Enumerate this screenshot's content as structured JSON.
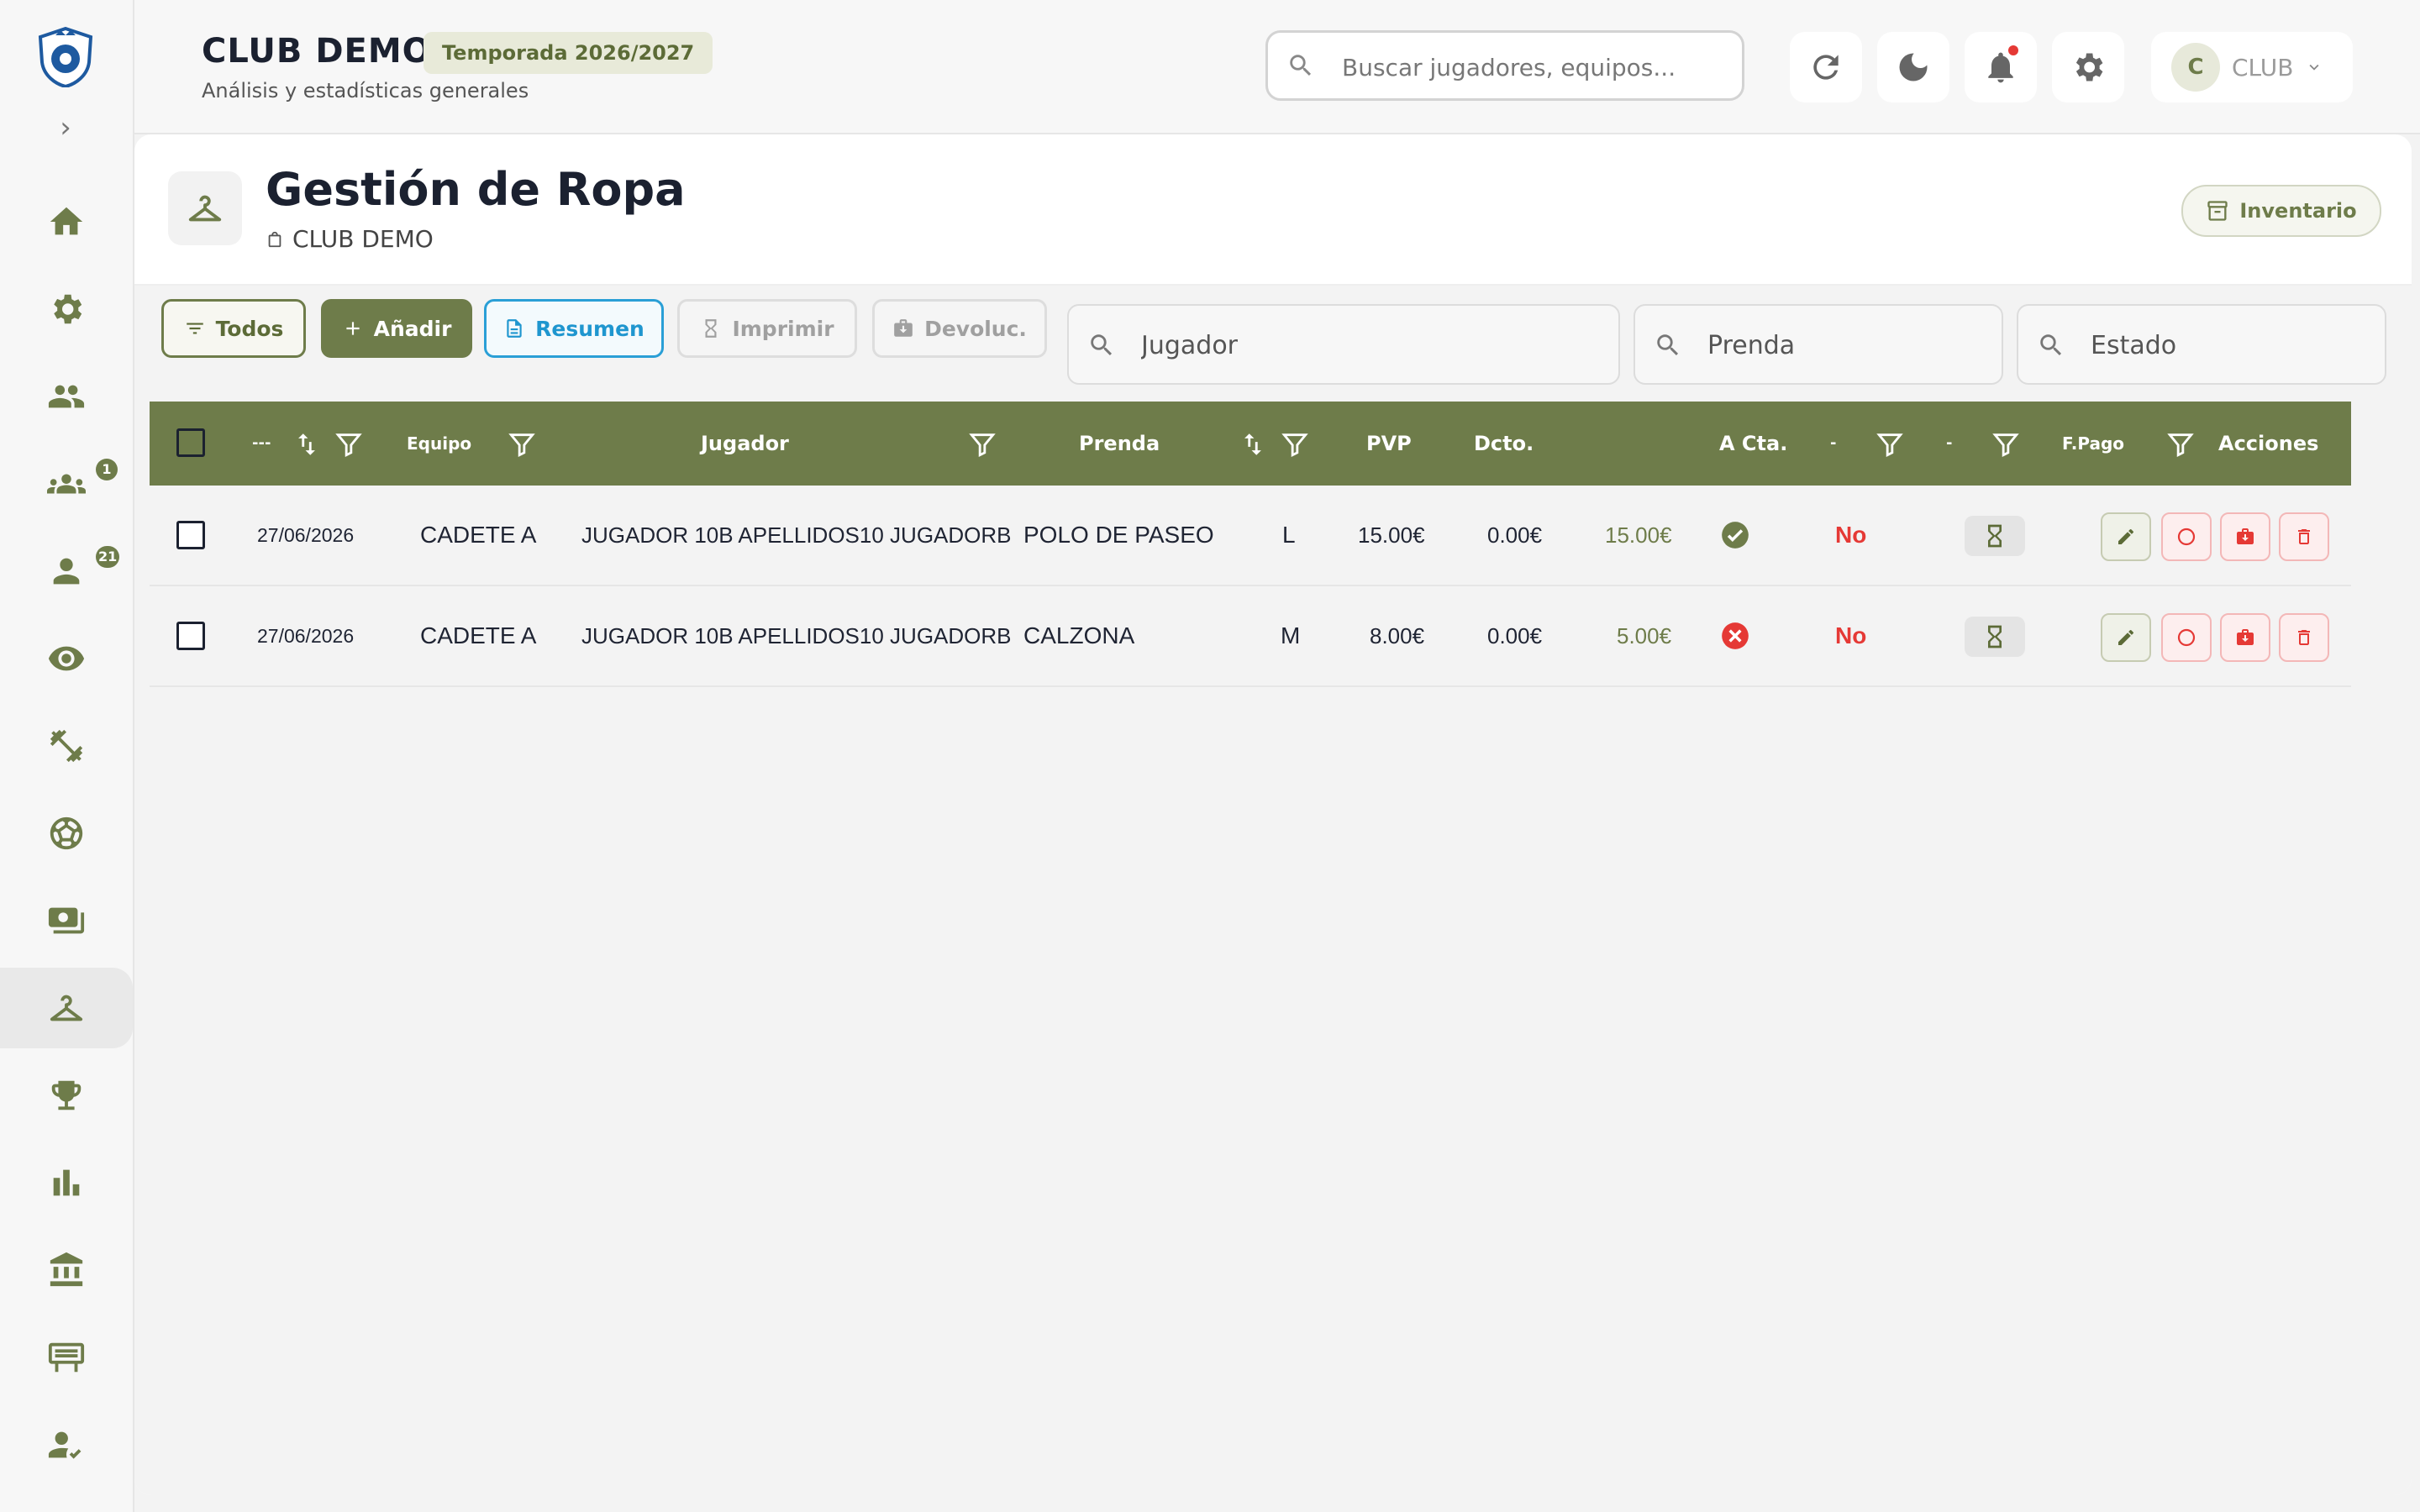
{
  "header": {
    "club_title": "CLUB DEMO",
    "season": "Temporada 2026/2027",
    "subtitle": "Análisis y estadísticas generales",
    "search_placeholder": "Buscar jugadores, equipos...",
    "user_initial": "C",
    "user_name": "CLUB"
  },
  "sidebar": {
    "badges": {
      "groups": "1",
      "player": "21"
    }
  },
  "page": {
    "title": "Gestión de Ropa",
    "club": "CLUB DEMO",
    "inventory_label": "Inventario"
  },
  "toolbar": {
    "todos": "Todos",
    "add": "Añadir",
    "resumen": "Resumen",
    "imprimir": "Imprimir",
    "devoluc": "Devoluc."
  },
  "filters": {
    "jugador": "Jugador",
    "prenda": "Prenda",
    "estado": "Estado"
  },
  "table": {
    "columns": {
      "fecha": "---",
      "equipo": "Equipo",
      "jugador": "Jugador",
      "prenda": "Prenda",
      "pvp": "PVP",
      "dcto": "Dcto.",
      "acta": "A Cta.",
      "c1": "-",
      "c2": "-",
      "fpago": "F.Pago",
      "acciones": "Acciones"
    },
    "rows": [
      {
        "fecha": "27/06/2026",
        "equipo": "CADETE A",
        "jugador": "JUGADOR 10B APELLIDOS10 JUGADORB",
        "prenda": "POLO DE PASEO",
        "talla": "L",
        "pvp": "15.00€",
        "dcto": "0.00€",
        "acta": "15.00€",
        "pagado": "check",
        "entregado": "No"
      },
      {
        "fecha": "27/06/2026",
        "equipo": "CADETE A",
        "jugador": "JUGADOR 10B APELLIDOS10 JUGADORB",
        "prenda": "CALZONA",
        "talla": "M",
        "pvp": "8.00€",
        "dcto": "0.00€",
        "acta": "5.00€",
        "pagado": "cross",
        "entregado": "No"
      }
    ]
  },
  "colors": {
    "accent": "#6e7c4a",
    "danger": "#e53935",
    "info": "#1f96cf"
  }
}
